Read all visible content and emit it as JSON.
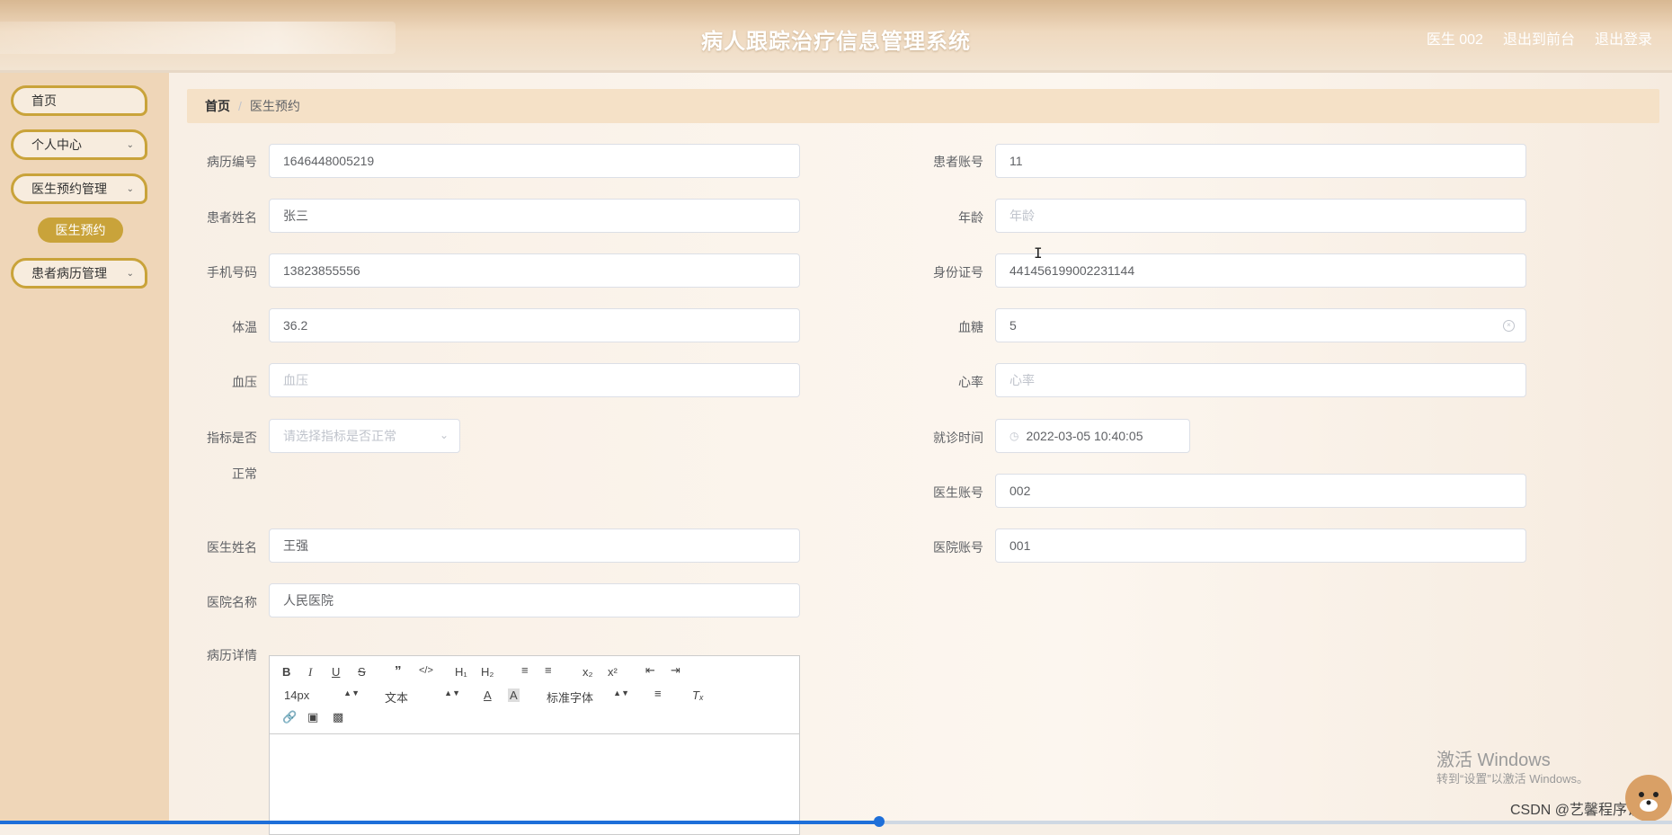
{
  "header": {
    "title": "病人跟踪治疗信息管理系统",
    "user": "医生 002",
    "front_link": "退出到前台",
    "logout": "退出登录"
  },
  "sidebar": {
    "items": [
      {
        "label": "首页"
      },
      {
        "label": "个人中心"
      },
      {
        "label": "医生预约管理"
      },
      {
        "label": "患者病历管理"
      }
    ],
    "sub_item": "医生预约"
  },
  "breadcrumb": {
    "home": "首页",
    "current": "医生预约"
  },
  "form": {
    "record_no": {
      "label": "病历编号",
      "value": "1646448005219"
    },
    "patient_account": {
      "label": "患者账号",
      "value": "11"
    },
    "patient_name": {
      "label": "患者姓名",
      "value": "张三"
    },
    "age": {
      "label": "年龄",
      "placeholder": "年龄"
    },
    "phone": {
      "label": "手机号码",
      "value": "13823855556"
    },
    "id_card": {
      "label": "身份证号",
      "value": "441456199002231144"
    },
    "temperature": {
      "label": "体温",
      "value": "36.2"
    },
    "blood_sugar": {
      "label": "血糖",
      "value": "5"
    },
    "blood_pressure": {
      "label": "血压",
      "placeholder": "血压"
    },
    "heart_rate": {
      "label": "心率",
      "placeholder": "心率"
    },
    "indicator_normal": {
      "label_line1": "指标是否",
      "label_line2": "正常",
      "placeholder": "请选择指标是否正常"
    },
    "visit_time": {
      "label": "就诊时间",
      "value": "2022-03-05 10:40:05"
    },
    "doctor_account": {
      "label": "医生账号",
      "value": "002"
    },
    "doctor_name": {
      "label": "医生姓名",
      "value": "王强"
    },
    "hospital_account": {
      "label": "医院账号",
      "value": "001"
    },
    "hospital_name": {
      "label": "医院名称",
      "value": "人民医院"
    },
    "record_detail": {
      "label": "病历详情"
    }
  },
  "editor": {
    "font_size": "14px",
    "block_type": "文本",
    "font_family": "标准字体"
  },
  "watermark": {
    "line1": "激活 Windows",
    "line2": "转到“设置”以激活 Windows。",
    "csdn": "CSDN @艺馨程序设计"
  },
  "progress": {
    "fraction": 0.526
  }
}
